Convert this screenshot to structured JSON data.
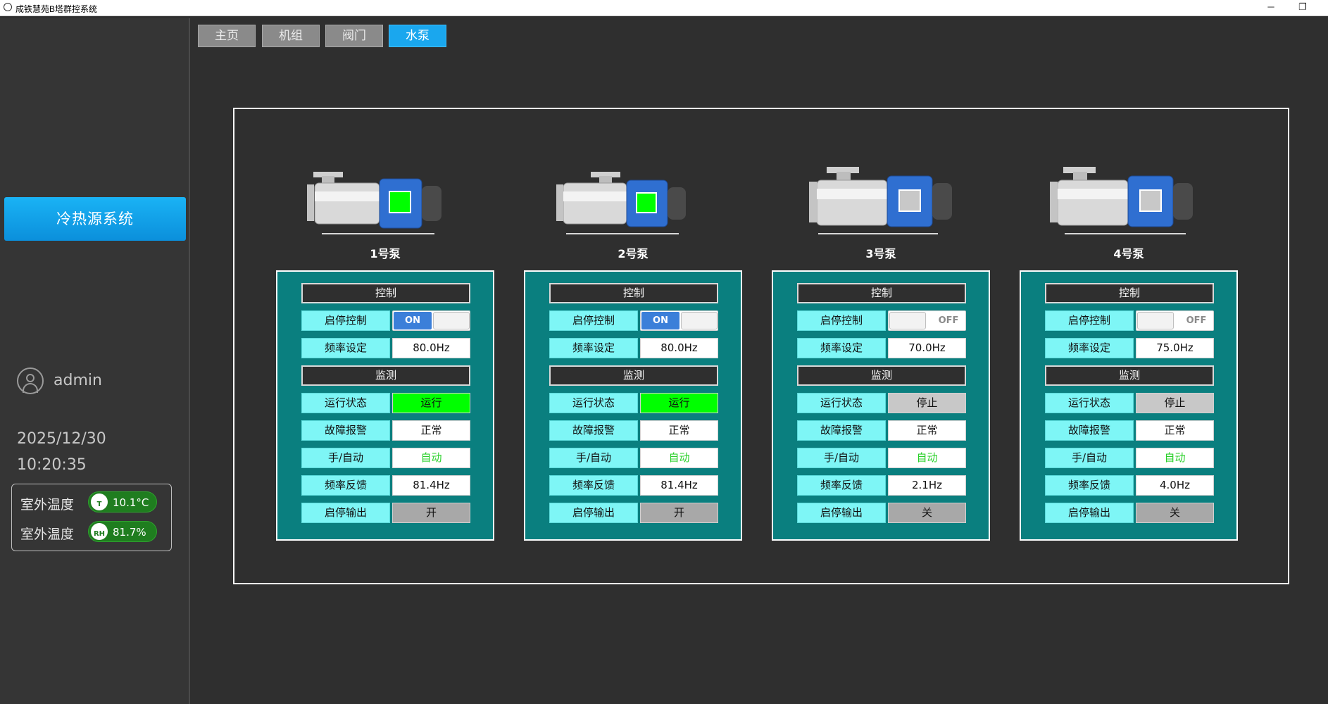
{
  "window": {
    "title": "成铁慧苑B塔群控系统",
    "minimize_glyph": "─",
    "restore_glyph": "❐"
  },
  "tabs": [
    {
      "label": "主页",
      "active": false
    },
    {
      "label": "机组",
      "active": false
    },
    {
      "label": "阀门",
      "active": false
    },
    {
      "label": "水泵",
      "active": true
    }
  ],
  "sidebar": {
    "system_button": "冷热源系统",
    "username": "admin",
    "date": "2025/12/30",
    "time": "10:20:35",
    "env": [
      {
        "label": "室外温度",
        "icon": "thermometer-icon",
        "icon_text": "T",
        "value": "10.1°C"
      },
      {
        "label": "室外温度",
        "icon": "humidity-icon",
        "icon_text": "RH",
        "value": "81.7%"
      }
    ]
  },
  "section_labels": {
    "control": "控制",
    "monitor": "监测",
    "start_stop": "启停控制",
    "freq_set": "频率设定",
    "run_status": "运行状态",
    "fault": "故障报警",
    "manual_auto": "手/自动",
    "freq_feedback": "频率反馈",
    "start_stop_output": "启停输出"
  },
  "pumps": [
    {
      "name": "1号泵",
      "switch": "ON",
      "freq_set": "80.0Hz",
      "run_status": "运行",
      "status_color": "#00ff00",
      "fault": "正常",
      "mode": "自动",
      "freq_feedback": "81.4Hz",
      "output": "开"
    },
    {
      "name": "2号泵",
      "switch": "ON",
      "freq_set": "80.0Hz",
      "run_status": "运行",
      "status_color": "#00ff00",
      "fault": "正常",
      "mode": "自动",
      "freq_feedback": "81.4Hz",
      "output": "开"
    },
    {
      "name": "3号泵",
      "switch": "OFF",
      "freq_set": "70.0Hz",
      "run_status": "停止",
      "status_color": "#c8c8c8",
      "fault": "正常",
      "mode": "自动",
      "freq_feedback": "2.1Hz",
      "output": "关"
    },
    {
      "name": "4号泵",
      "switch": "OFF",
      "freq_set": "75.0Hz",
      "run_status": "停止",
      "status_color": "#c8c8c8",
      "fault": "正常",
      "mode": "自动",
      "freq_feedback": "4.0Hz",
      "output": "关"
    }
  ]
}
